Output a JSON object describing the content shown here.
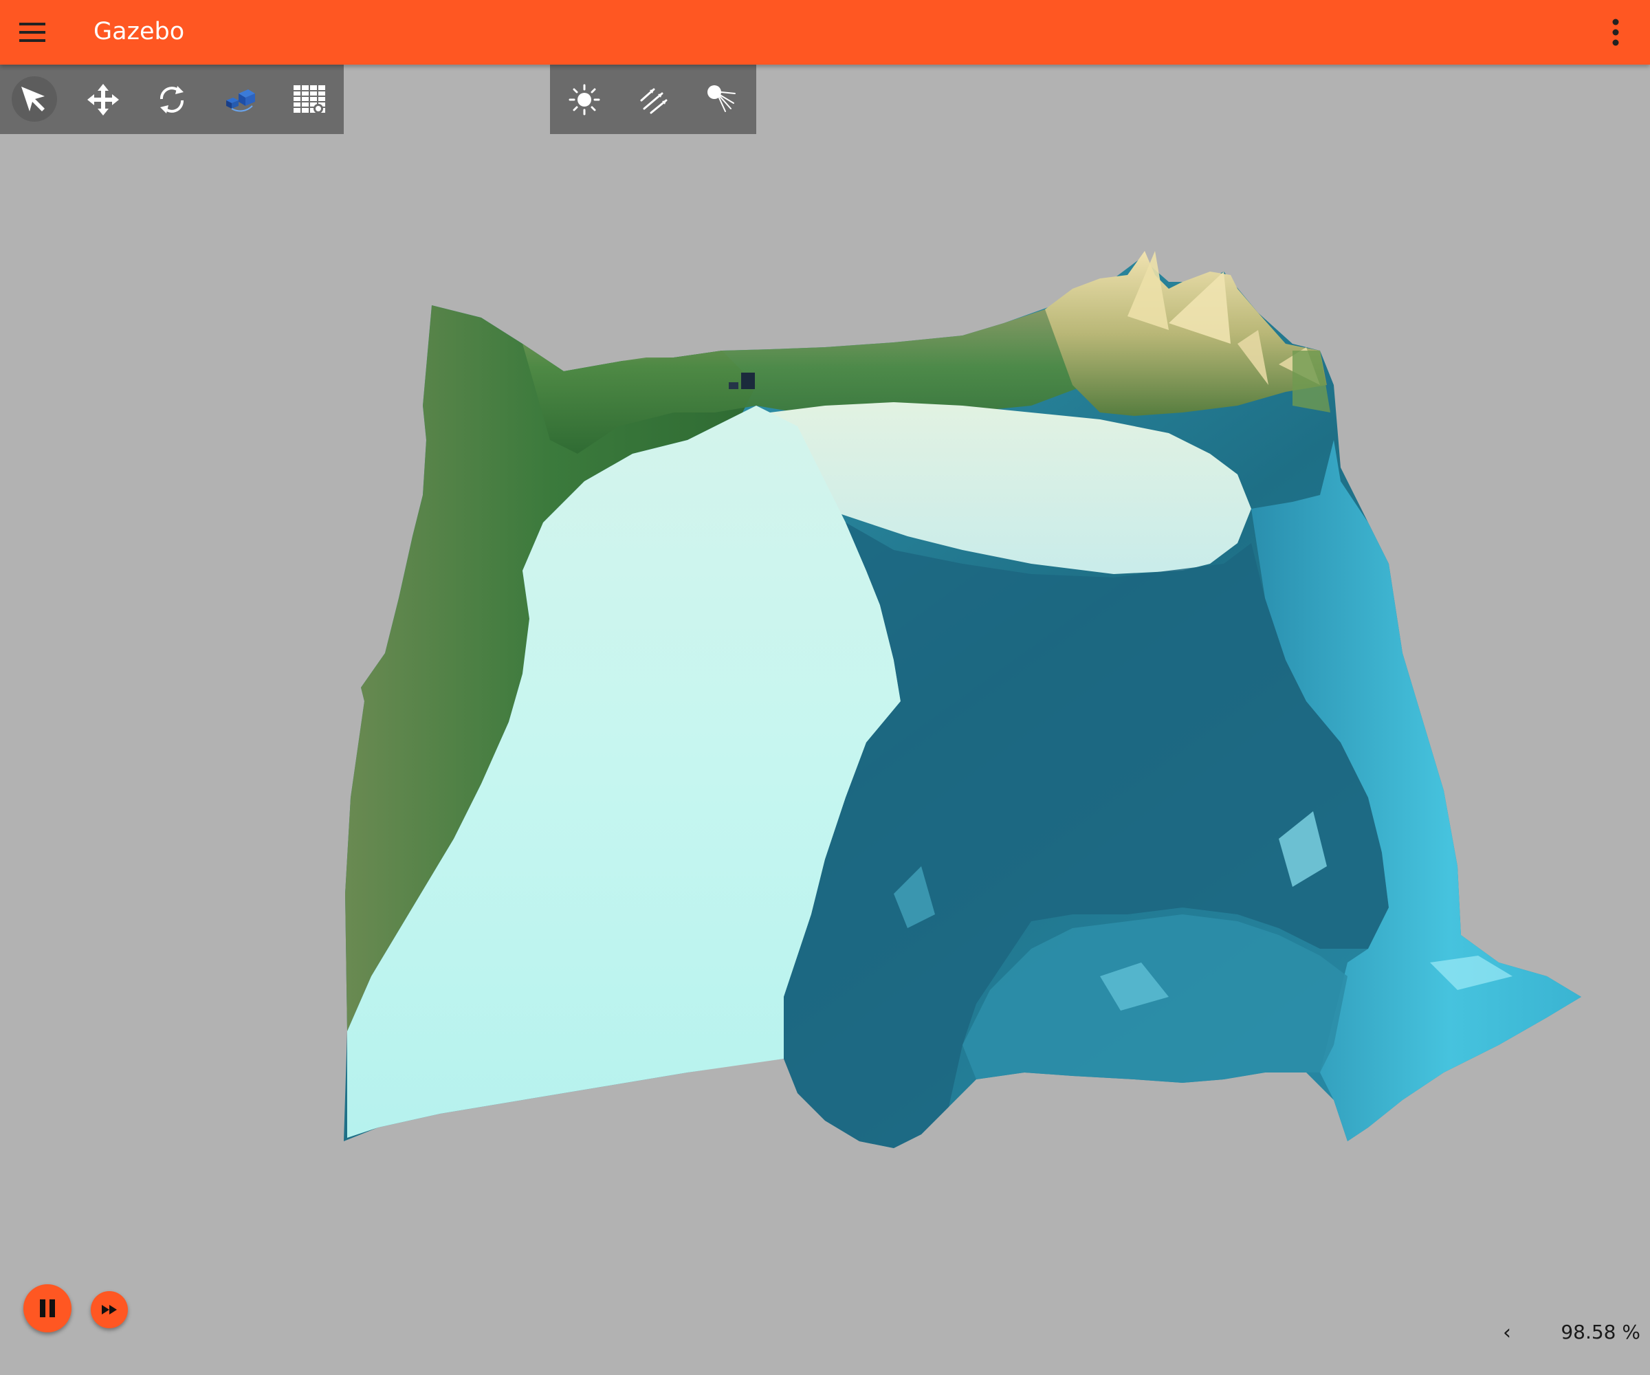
{
  "app": {
    "title": "Gazebo"
  },
  "icons": {
    "menu": "hamburger-menu-icon",
    "overflow": "kebab-menu-icon"
  },
  "toolbar_left": {
    "tools": [
      {
        "id": "select",
        "icon": "select-arrow-icon",
        "selected": true
      },
      {
        "id": "translate",
        "icon": "translate-move-icon",
        "selected": false
      },
      {
        "id": "rotate",
        "icon": "rotate-icon",
        "selected": false
      },
      {
        "id": "transform-control",
        "icon": "transform-control-icon",
        "selected": false
      },
      {
        "id": "grid",
        "icon": "grid-icon",
        "selected": false
      }
    ]
  },
  "toolbar_right": {
    "tools": [
      {
        "id": "point-light",
        "icon": "sun-light-icon"
      },
      {
        "id": "directional-light",
        "icon": "directional-light-icon"
      },
      {
        "id": "spot-light",
        "icon": "spot-light-icon"
      }
    ]
  },
  "playback": {
    "state": "playing",
    "play_icon": "pause-icon",
    "step_icon": "fast-forward-icon"
  },
  "stats": {
    "toggle_glyph": "‹",
    "real_time_factor": "98.58 %"
  },
  "colors": {
    "accent": "#ff5722",
    "background": "#b2b2b2",
    "toolbar": "#6b6b6b"
  }
}
